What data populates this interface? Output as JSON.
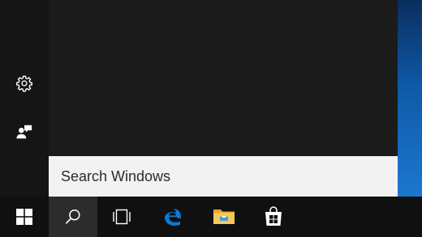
{
  "search": {
    "placeholder": "Search Windows"
  },
  "rail": {
    "items": [
      {
        "icon": "gear-icon"
      },
      {
        "icon": "feedback-icon"
      }
    ]
  },
  "taskbar": {
    "items": [
      {
        "icon": "windows-logo-icon"
      },
      {
        "icon": "search-icon",
        "active": true
      },
      {
        "icon": "task-view-icon"
      },
      {
        "icon": "edge-icon"
      },
      {
        "icon": "file-explorer-icon"
      },
      {
        "icon": "store-icon"
      }
    ]
  },
  "colors": {
    "panel": "#1f1f1f",
    "rail": "#151515",
    "search_box": "#f2f2f2",
    "taskbar": "#101010",
    "taskbar_active": "#2c2c2c",
    "accent": "#0078d7"
  }
}
